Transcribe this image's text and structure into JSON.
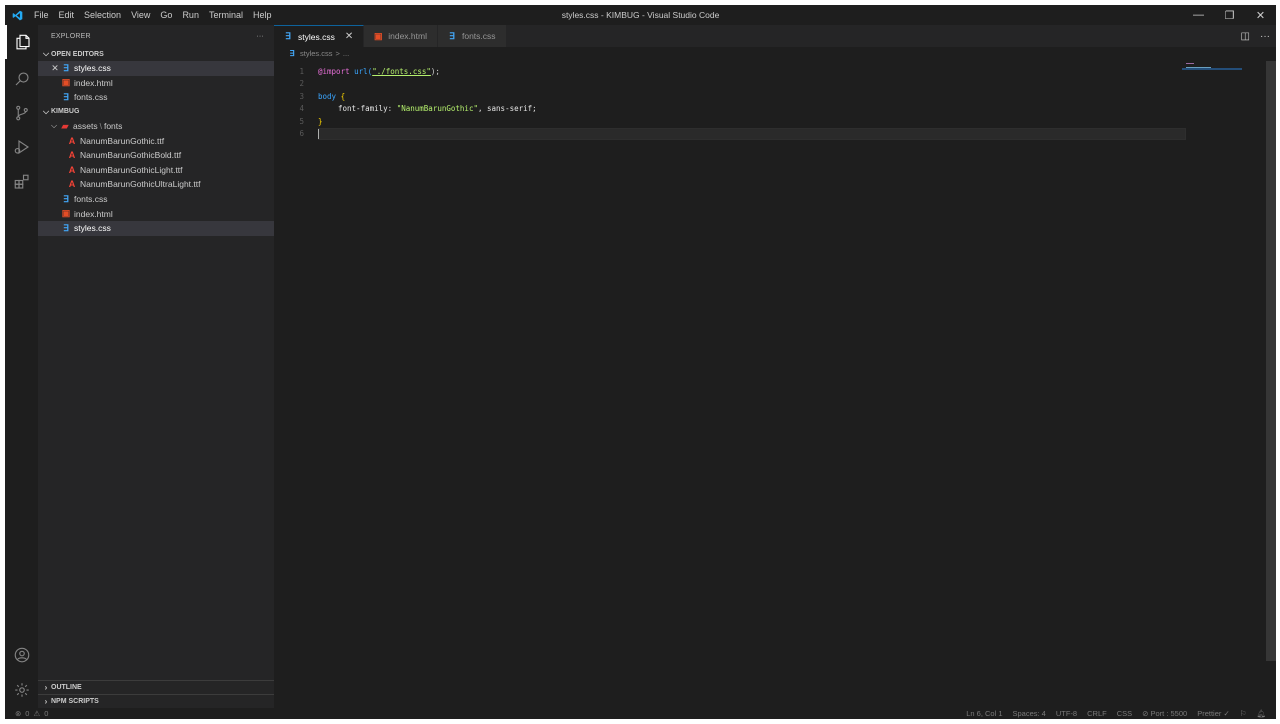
{
  "titlebar": {
    "menu": [
      "File",
      "Edit",
      "Selection",
      "View",
      "Go",
      "Run",
      "Terminal",
      "Help"
    ],
    "title": "styles.css - KIMBUG - Visual Studio Code",
    "controls": {
      "minimize": "—",
      "restore": "❐",
      "close": "✕"
    }
  },
  "activitybar": {
    "items": [
      "explorer-icon",
      "search-icon",
      "source-control-icon",
      "run-debug-icon",
      "extensions-icon"
    ],
    "bottom": [
      "accounts-icon",
      "settings-gear-icon"
    ]
  },
  "sidebar": {
    "header": "EXPLORER",
    "header_actions": "···",
    "open_editors": {
      "label": "OPEN EDITORS",
      "items": [
        {
          "name": "styles.css",
          "type": "css"
        },
        {
          "name": "index.html",
          "type": "html"
        },
        {
          "name": "fonts.css",
          "type": "css"
        }
      ]
    },
    "workspace": {
      "label": "KIMBUG",
      "folder": {
        "name": "assets",
        "sep": "\\",
        "sub": "fonts"
      },
      "font_files": [
        "NanumBarunGothic.ttf",
        "NanumBarunGothicBold.ttf",
        "NanumBarunGothicLight.ttf",
        "NanumBarunGothicUltraLight.ttf"
      ],
      "root_files": [
        {
          "name": "fonts.css",
          "type": "css"
        },
        {
          "name": "index.html",
          "type": "html"
        },
        {
          "name": "styles.css",
          "type": "css"
        }
      ]
    },
    "bottom_sections": [
      "OUTLINE",
      "NPM SCRIPTS"
    ]
  },
  "editor": {
    "tabs": [
      {
        "name": "styles.css",
        "type": "css",
        "active": true
      },
      {
        "name": "index.html",
        "type": "html",
        "active": false
      },
      {
        "name": "fonts.css",
        "type": "css",
        "active": false
      }
    ],
    "breadcrumb": {
      "file": "styles.css",
      "sep": ">",
      "rest": "..."
    },
    "line_numbers": [
      "1",
      "2",
      "3",
      "4",
      "5",
      "6"
    ],
    "code": {
      "l1_at": "@import",
      "l1_fn": "url(",
      "l1_str": "\"./fonts.css\"",
      "l1_end": ");",
      "l3_sel": "body",
      "l3_brace": " {",
      "l4_prop": "font-family",
      "l4_colon": ": ",
      "l4_str": "\"NanumBarunGothic\"",
      "l4_rest": ", sans-serif;",
      "l5_brace": "}"
    }
  },
  "statusbar": {
    "left": {
      "errors": "0",
      "warnings": "0"
    },
    "right": [
      "Ln 6, Col 1",
      "Spaces: 4",
      "UTF-8",
      "CRLF",
      "CSS",
      "⊘ Port : 5500",
      "Prettier ✓"
    ]
  },
  "colors": {
    "accent": "#0e639c",
    "css_icon": "#42a5f5",
    "html_icon": "#e44d26",
    "font_icon": "#f44336"
  }
}
